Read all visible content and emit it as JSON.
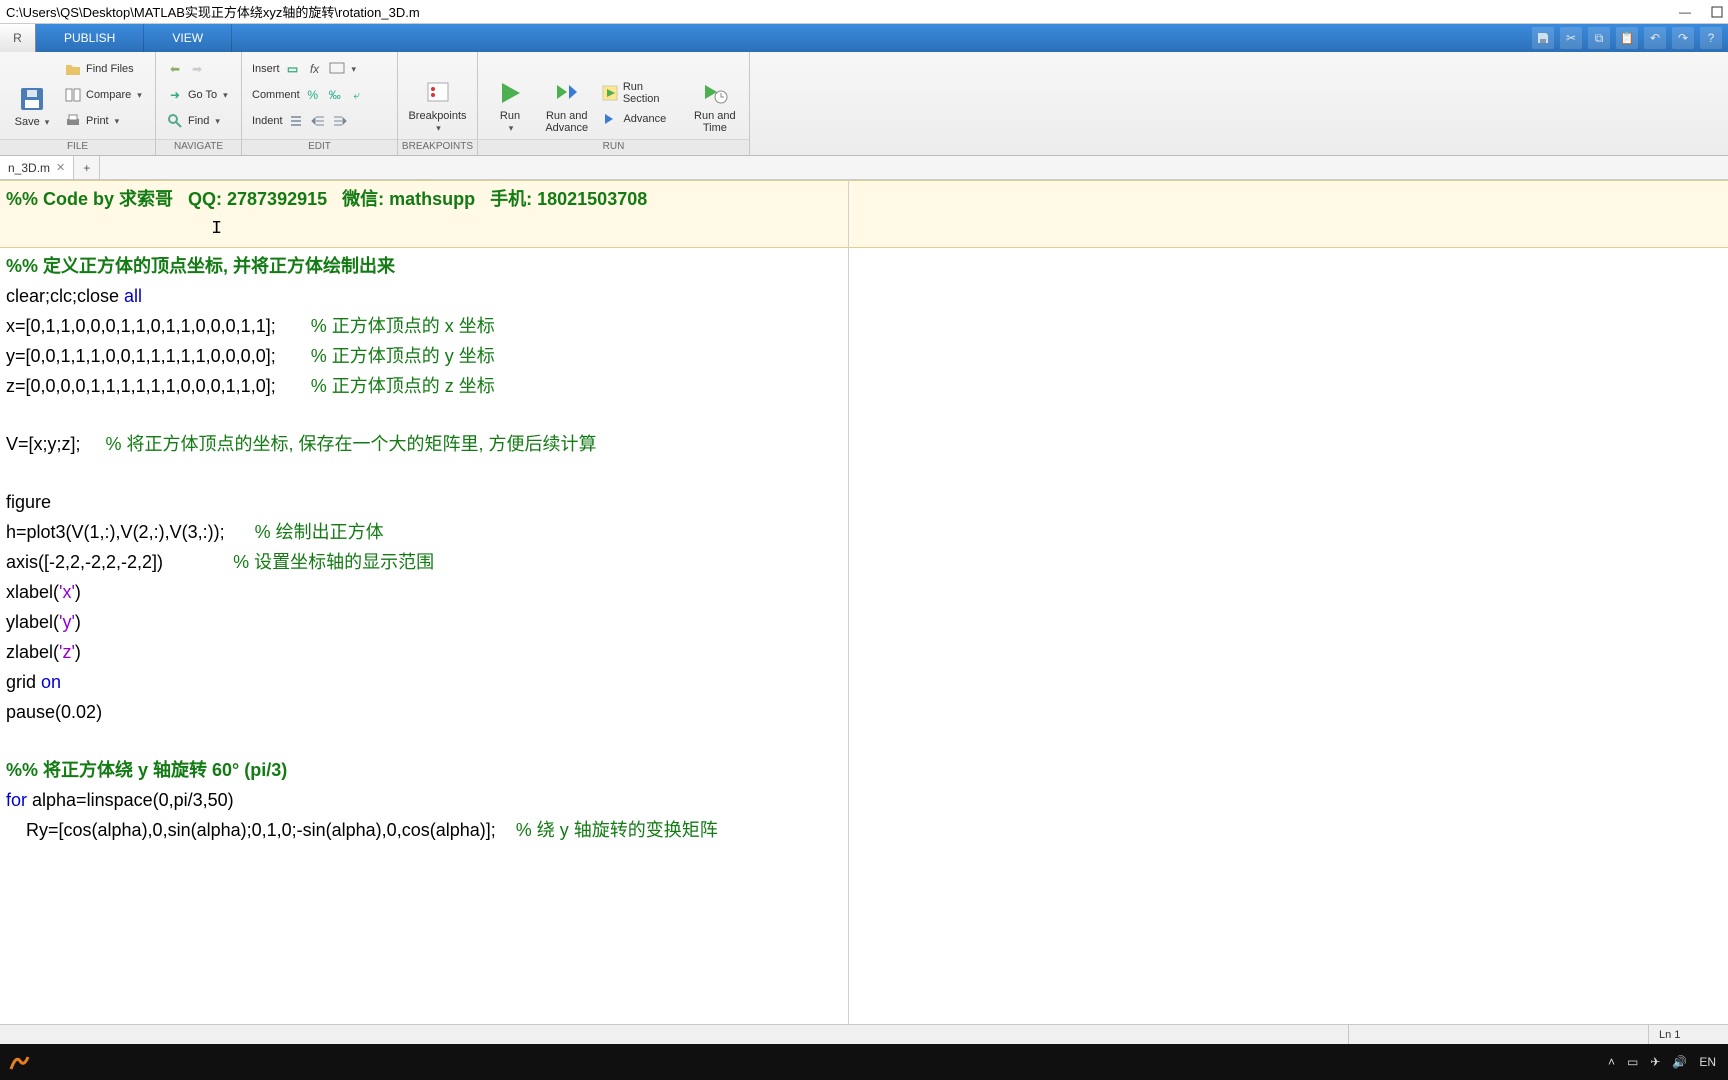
{
  "window": {
    "title": "C:\\Users\\QS\\Desktop\\MATLAB实现正方体绕xyz轴的旋转\\rotation_3D.m"
  },
  "ribbon_tabs": {
    "stub": "R",
    "items": [
      "PUBLISH",
      "VIEW"
    ]
  },
  "ribbon": {
    "file": {
      "save": "Save",
      "find_files": "Find Files",
      "compare": "Compare",
      "print": "Print",
      "title": "FILE"
    },
    "navigate": {
      "goto": "Go To",
      "find": "Find",
      "title": "NAVIGATE"
    },
    "edit": {
      "insert": "Insert",
      "comment": "Comment",
      "indent": "Indent",
      "title": "EDIT"
    },
    "breakpoints": {
      "label": "Breakpoints",
      "title": "BREAKPOINTS"
    },
    "run": {
      "run": "Run",
      "run_and_advance": "Run and\nAdvance",
      "run_section": "Run Section",
      "advance": "Advance",
      "run_and_time": "Run and\nTime",
      "title": "RUN"
    }
  },
  "file_tab": {
    "name": "n_3D.m"
  },
  "status": {
    "ln": "Ln  1"
  },
  "tray": {
    "lang": "EN"
  },
  "code": {
    "l1_a": "%% Code by 求索哥   QQ: 2787392915   微信: mathsupp   手机: 18021503708",
    "l3": "%% 定义正方体的顶点坐标, 并将正方体绘制出来",
    "l4_a": "clear;clc;close ",
    "l4_b": "all",
    "l5_a": "x=[0,1,1,0,0,0,1,1,0,1,1,0,0,0,1,1];       ",
    "l5_b": "% 正方体顶点的 x 坐标",
    "l6_a": "y=[0,0,1,1,1,0,0,1,1,1,1,1,0,0,0,0];       ",
    "l6_b": "% 正方体顶点的 y 坐标",
    "l7_a": "z=[0,0,0,0,1,1,1,1,1,1,0,0,0,1,1,0];       ",
    "l7_b": "% 正方体顶点的 z 坐标",
    "l9_a": "V=[x;y;z];     ",
    "l9_b": "% 将正方体顶点的坐标, 保存在一个大的矩阵里, 方便后续计算",
    "l11": "figure",
    "l12_a": "h=plot3(V(1,:),V(2,:),V(3,:));      ",
    "l12_b": "% 绘制出正方体",
    "l13_a": "axis([-2,2,-2,2,-2,2])              ",
    "l13_b": "% 设置坐标轴的显示范围",
    "l14_a": "xlabel(",
    "l14_b": "'x'",
    "l14_c": ")",
    "l15_a": "ylabel(",
    "l15_b": "'y'",
    "l15_c": ")",
    "l16_a": "zlabel(",
    "l16_b": "'z'",
    "l16_c": ")",
    "l17_a": "grid ",
    "l17_b": "on",
    "l18": "pause(0.02)",
    "l20": "%% 将正方体绕 y 轴旋转 60° (pi/3)",
    "l21_a": "for",
    "l21_b": " alpha=linspace(0,pi/3,50)",
    "l22_a": "    Ry=[cos(alpha),0,sin(alpha);0,1,0;-sin(alpha),0,cos(alpha)];    ",
    "l22_b": "% 绕 y 轴旋转的变换矩阵"
  }
}
